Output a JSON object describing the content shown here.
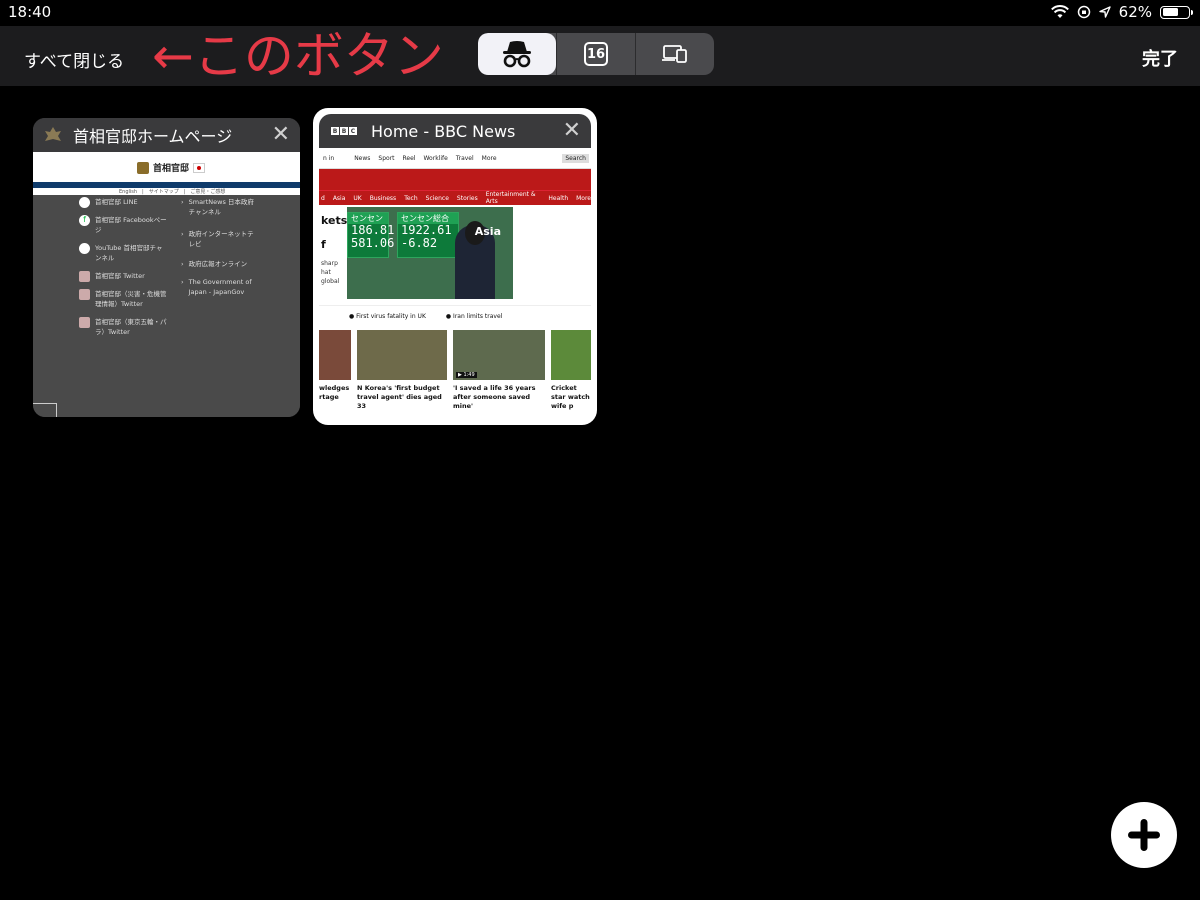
{
  "status": {
    "time": "18:40",
    "battery": "62%",
    "battery_level": 0.62
  },
  "toolbar": {
    "close_all": "すべて閉じる",
    "annotation": "←このボタン",
    "tab_count": "16",
    "done": "完了"
  },
  "tabs": [
    {
      "title": "首相官邸ホームページ",
      "preview": {
        "logo": "首相官邸",
        "nav": "English　|　サイトマップ　|　ご意見・ご感想",
        "items": [
          "首相官邸 LINE",
          "首相官邸 Facebookページ",
          "YouTube 首相官邸チャンネル",
          "首相官邸 Twitter",
          "首相官邸（災害・危機管理情報）Twitter",
          "首相官邸（東京五輪・パラ）Twitter",
          "SmartNews 日本政府チャンネル",
          "政府インターネットテレビ",
          "政府広報オンライン",
          "The Government of Japan - JapanGov"
        ]
      }
    },
    {
      "title": "Home - BBC News",
      "preview": {
        "nav": [
          "n in",
          "News",
          "Sport",
          "Reel",
          "Worklife",
          "Travel",
          "More"
        ],
        "search": "Search",
        "sections": [
          "d",
          "Asia",
          "UK",
          "Business",
          "Tech",
          "Science",
          "Stories",
          "Entertainment & Arts",
          "Health",
          "More"
        ],
        "hero_text": [
          "kets",
          "f",
          "sharp",
          "hat",
          "global"
        ],
        "board_left": {
          "label": "センセン",
          "n1": "186.81",
          "n2": "581.06"
        },
        "board_right": {
          "label": "センセン総合",
          "n1": "1922.61",
          "n2": "-6.82"
        },
        "hero_tag": "Asia",
        "links": [
          "First virus fatality in UK",
          "Iran limits travel"
        ],
        "stories": [
          "wledges rtage",
          "N Korea's 'first budget travel agent' dies aged 33",
          "'I saved a life 36 years after someone saved mine'",
          "Cricket star watch wife p"
        ],
        "video_time": "1:49"
      }
    }
  ],
  "colors": {
    "annotation": "#e63a47",
    "bbc_red": "#bb1919",
    "toolbar_bg": "#1c1c1e"
  },
  "icons": {
    "incognito": "incognito-icon",
    "devices": "devices-icon",
    "new_tab": "plus-icon"
  }
}
